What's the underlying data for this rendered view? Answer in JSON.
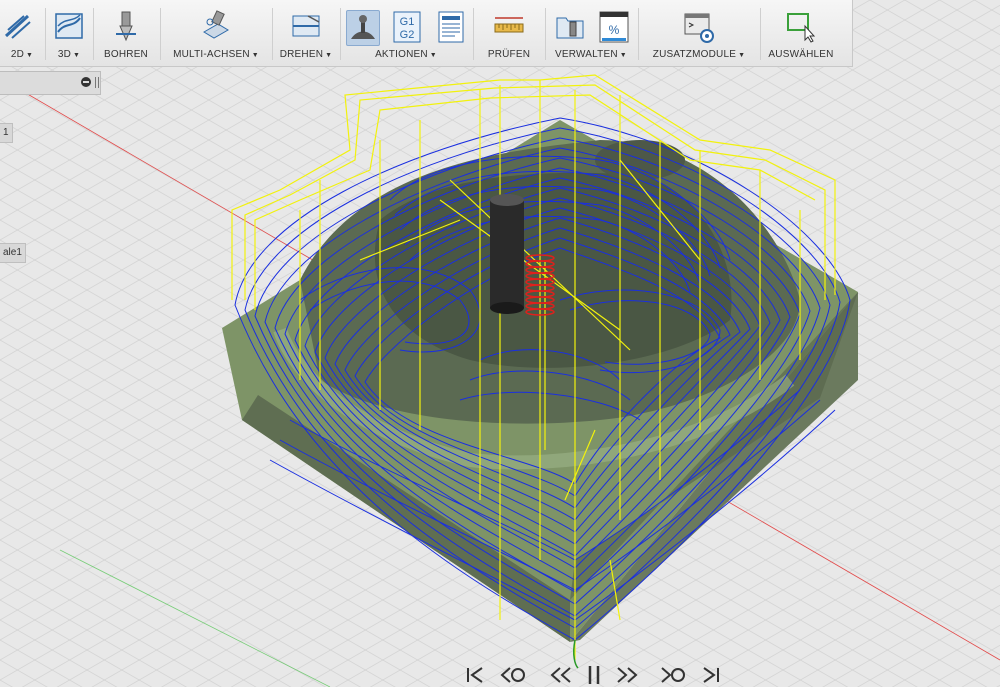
{
  "toolbar": {
    "groups": [
      {
        "label": "2D",
        "dropdown": true,
        "icon": "2d-milling-icon"
      },
      {
        "label": "3D",
        "dropdown": true,
        "icon": "3d-milling-icon"
      },
      {
        "label": "BOHREN",
        "dropdown": false,
        "icon": "drill-icon"
      },
      {
        "label": "MULTI-ACHSEN",
        "dropdown": true,
        "icon": "multi-axis-icon"
      },
      {
        "label": "DREHEN",
        "dropdown": true,
        "icon": "turning-icon"
      },
      {
        "label": "AKTIONEN",
        "dropdown": true,
        "icon": "simulate-icon"
      },
      {
        "label": "PRÜFEN",
        "dropdown": false,
        "icon": "measure-icon"
      },
      {
        "label": "VERWALTEN",
        "dropdown": true,
        "icon": "tool-library-icon"
      },
      {
        "label": "ZUSATZMODULE",
        "dropdown": true,
        "icon": "addins-icon"
      },
      {
        "label": "AUSWÄHLEN",
        "dropdown": false,
        "icon": "select-icon"
      }
    ],
    "g_code_icon_text": [
      "G1",
      "G2"
    ],
    "percent_icon_text": "%"
  },
  "browser": {
    "tag1": "1",
    "tag2": "ale1"
  },
  "playback": {
    "controls": [
      "skip-start",
      "step-back",
      "rewind",
      "pause",
      "fast-forward",
      "step-forward",
      "skip-end"
    ]
  },
  "colors": {
    "toolpath_blue": "#1a2fe0",
    "rapid_yellow": "#f2f20c",
    "stock_green": "#7e9467",
    "tool_red": "#e0201c",
    "active_button": "#bcd0e6"
  }
}
